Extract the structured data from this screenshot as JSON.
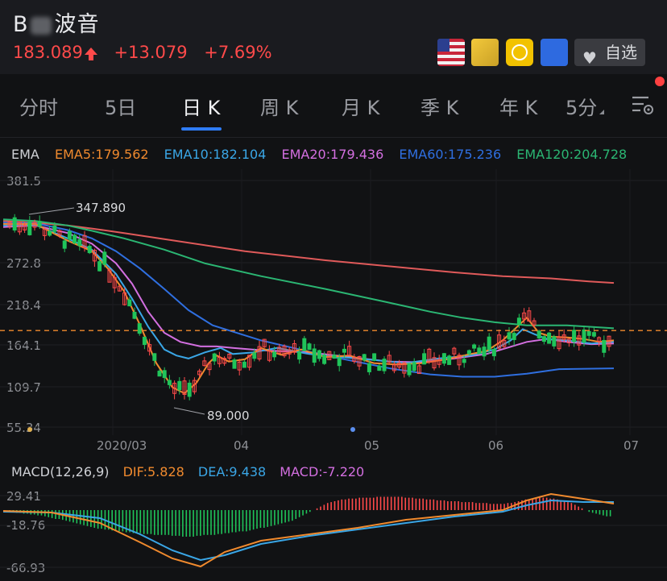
{
  "header": {
    "title_prefix": "B",
    "title_suffix": "波音",
    "price": "183.089",
    "change": "+13.079",
    "change_pct": "+7.69%",
    "watchlist_label": "自选"
  },
  "tabs": [
    "分时",
    "5日",
    "日 K",
    "周 K",
    "月 K",
    "季 K",
    "年 K",
    "5分"
  ],
  "active_tab": "日 K",
  "ema": {
    "label": "EMA",
    "ema5": "EMA5:179.562",
    "ema10": "EMA10:182.104",
    "ema20": "EMA20:179.436",
    "ema60": "EMA60:175.236",
    "ema120": "EMA120:204.728"
  },
  "macd": {
    "label": "MACD(12,26,9)",
    "dif": "DIF:5.828",
    "dea": "DEA:9.438",
    "macd": "MACD:-7.220"
  },
  "colors": {
    "up": "#ff4a4a",
    "down": "#20c45a",
    "ema5": "#f08a2e",
    "ema10": "#3aa6e6",
    "ema20": "#d36fe0",
    "ema60": "#2f6fe0",
    "ema120": "#2bb673",
    "ema_long": "#e05a5a",
    "accent": "#2f7cf6"
  },
  "chart_data": {
    "type": "candlestick",
    "y_ticks": [
      "381.5",
      "272.8",
      "218.4",
      "164.1",
      "109.7",
      "55.34"
    ],
    "x_ticks": [
      "2020/03",
      "04",
      "05",
      "06",
      "07"
    ],
    "annotations": {
      "high": "347.890",
      "low": "89.000"
    },
    "current_price": 183.089,
    "ylim": [
      55.34,
      381.5
    ],
    "ema_lines": {
      "ema_long": [
        [
          0,
          328
        ],
        [
          35,
          326
        ],
        [
          80,
          322
        ],
        [
          110,
          318
        ],
        [
          150,
          312
        ],
        [
          200,
          304
        ],
        [
          300,
          288
        ],
        [
          400,
          276
        ],
        [
          500,
          266
        ],
        [
          560,
          260
        ],
        [
          620,
          255
        ],
        [
          680,
          252
        ],
        [
          727,
          248
        ],
        [
          758,
          246
        ]
      ],
      "ema120": [
        [
          0,
          330
        ],
        [
          40,
          328
        ],
        [
          80,
          322
        ],
        [
          110,
          315
        ],
        [
          150,
          305
        ],
        [
          200,
          290
        ],
        [
          250,
          272
        ],
        [
          320,
          255
        ],
        [
          400,
          238
        ],
        [
          470,
          222
        ],
        [
          530,
          208
        ],
        [
          570,
          200
        ],
        [
          610,
          194
        ],
        [
          650,
          190
        ],
        [
          700,
          190
        ],
        [
          758,
          186
        ]
      ],
      "ema60": [
        [
          0,
          326
        ],
        [
          40,
          325
        ],
        [
          80,
          316
        ],
        [
          110,
          305
        ],
        [
          140,
          288
        ],
        [
          170,
          265
        ],
        [
          200,
          238
        ],
        [
          230,
          210
        ],
        [
          260,
          190
        ],
        [
          320,
          170
        ],
        [
          400,
          150
        ],
        [
          480,
          133
        ],
        [
          530,
          125
        ],
        [
          570,
          122
        ],
        [
          610,
          122
        ],
        [
          650,
          126
        ],
        [
          690,
          132
        ],
        [
          758,
          133
        ]
      ],
      "ema20": [
        [
          0,
          320
        ],
        [
          40,
          322
        ],
        [
          80,
          312
        ],
        [
          110,
          298
        ],
        [
          140,
          272
        ],
        [
          160,
          245
        ],
        [
          180,
          208
        ],
        [
          200,
          180
        ],
        [
          220,
          168
        ],
        [
          245,
          162
        ],
        [
          265,
          162
        ],
        [
          285,
          160
        ],
        [
          320,
          157
        ],
        [
          380,
          154
        ],
        [
          430,
          148
        ],
        [
          480,
          142
        ],
        [
          520,
          141
        ],
        [
          560,
          146
        ],
        [
          600,
          152
        ],
        [
          625,
          160
        ],
        [
          650,
          168
        ],
        [
          675,
          172
        ],
        [
          700,
          168
        ],
        [
          730,
          165
        ],
        [
          758,
          166
        ]
      ],
      "ema10": [
        [
          0,
          322
        ],
        [
          40,
          323
        ],
        [
          80,
          305
        ],
        [
          110,
          290
        ],
        [
          140,
          258
        ],
        [
          160,
          225
        ],
        [
          180,
          188
        ],
        [
          200,
          158
        ],
        [
          215,
          150
        ],
        [
          230,
          146
        ],
        [
          250,
          154
        ],
        [
          270,
          160
        ],
        [
          285,
          152
        ],
        [
          310,
          154
        ],
        [
          340,
          160
        ],
        [
          380,
          152
        ],
        [
          420,
          148
        ],
        [
          460,
          144
        ],
        [
          500,
          140
        ],
        [
          540,
          146
        ],
        [
          580,
          150
        ],
        [
          610,
          158
        ],
        [
          630,
          170
        ],
        [
          645,
          185
        ],
        [
          660,
          178
        ],
        [
          675,
          172
        ],
        [
          700,
          170
        ],
        [
          730,
          166
        ],
        [
          758,
          168
        ]
      ],
      "ema5": [
        [
          0,
          324
        ],
        [
          40,
          324
        ],
        [
          80,
          302
        ],
        [
          110,
          288
        ],
        [
          130,
          265
        ],
        [
          150,
          235
        ],
        [
          170,
          190
        ],
        [
          190,
          140
        ],
        [
          210,
          108
        ],
        [
          225,
          100
        ],
        [
          240,
          114
        ],
        [
          255,
          140
        ],
        [
          265,
          150
        ],
        [
          280,
          142
        ],
        [
          300,
          145
        ],
        [
          320,
          160
        ],
        [
          345,
          151
        ],
        [
          370,
          158
        ],
        [
          400,
          148
        ],
        [
          430,
          150
        ],
        [
          460,
          140
        ],
        [
          490,
          138
        ],
        [
          520,
          140
        ],
        [
          550,
          145
        ],
        [
          580,
          152
        ],
        [
          600,
          156
        ],
        [
          620,
          170
        ],
        [
          640,
          190
        ],
        [
          650,
          200
        ],
        [
          665,
          180
        ],
        [
          680,
          175
        ],
        [
          700,
          174
        ],
        [
          720,
          172
        ],
        [
          740,
          168
        ],
        [
          758,
          170
        ]
      ]
    },
    "macd_lines": {
      "dif": [
        [
          0,
          41
        ],
        [
          60,
          43
        ],
        [
          120,
          56
        ],
        [
          170,
          80
        ],
        [
          210,
          100
        ],
        [
          245,
          110
        ],
        [
          275,
          92
        ],
        [
          320,
          78
        ],
        [
          380,
          70
        ],
        [
          440,
          62
        ],
        [
          500,
          52
        ],
        [
          560,
          46
        ],
        [
          620,
          40
        ],
        [
          650,
          28
        ],
        [
          680,
          20
        ],
        [
          720,
          26
        ],
        [
          758,
          32
        ]
      ],
      "dea": [
        [
          0,
          42
        ],
        [
          60,
          43
        ],
        [
          120,
          50
        ],
        [
          170,
          70
        ],
        [
          210,
          90
        ],
        [
          245,
          102
        ],
        [
          275,
          96
        ],
        [
          320,
          82
        ],
        [
          380,
          72
        ],
        [
          440,
          64
        ],
        [
          500,
          56
        ],
        [
          560,
          48
        ],
        [
          620,
          42
        ],
        [
          650,
          34
        ],
        [
          680,
          28
        ],
        [
          720,
          30
        ],
        [
          758,
          30
        ]
      ]
    },
    "macd_hist": [
      -2,
      -2,
      -3,
      -3,
      -4,
      -4,
      -5,
      -5,
      -6,
      -6,
      -7,
      -8,
      -9,
      -10,
      -10,
      -11,
      -12,
      -13,
      -14,
      -15,
      -16,
      -17,
      -18,
      -19,
      -20,
      -21,
      -21,
      -22,
      -22,
      -23,
      -23,
      -24,
      -24,
      -25,
      -25,
      -26,
      -26,
      -26,
      -27,
      -27,
      -27,
      -28,
      -28,
      -28,
      -28,
      -28,
      -29,
      -29,
      -29,
      -30,
      -30,
      -30,
      -30,
      -29,
      -29,
      -28,
      -28,
      -28,
      -28,
      -27,
      -27,
      -26,
      -26,
      -25,
      -25,
      -24,
      -24,
      -24,
      -23,
      -22,
      -21,
      -20,
      -20,
      -19,
      -18,
      -17,
      -16,
      -15,
      -14,
      -13,
      -12,
      -10,
      -8,
      -6,
      -4,
      -2,
      0,
      2,
      4,
      6,
      8,
      9,
      10,
      11,
      12,
      12,
      13,
      13,
      13,
      14,
      14,
      14,
      14,
      14,
      15,
      15,
      15,
      15,
      15,
      15,
      15,
      15,
      14,
      14,
      14,
      13,
      13,
      13,
      12,
      12,
      12,
      11,
      11,
      11,
      10,
      10,
      10,
      10,
      9,
      9,
      9,
      9,
      8,
      8,
      8,
      8,
      7,
      7,
      7,
      7,
      7,
      8,
      8,
      9,
      10,
      11,
      12,
      12,
      13,
      14,
      14,
      14,
      14,
      13,
      13,
      12,
      11,
      10,
      9,
      8,
      6,
      4,
      2,
      0,
      -2,
      -3,
      -4,
      -5,
      -6,
      -7,
      -7
    ]
  }
}
